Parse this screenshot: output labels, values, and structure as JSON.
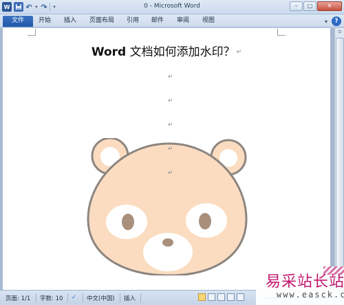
{
  "window": {
    "title": "0 - Microsoft Word",
    "minimize": "–",
    "maximize": "□",
    "close": "✕"
  },
  "qat": {
    "word_logo": "W",
    "icons": [
      "word-logo-icon",
      "save-icon",
      "undo-icon",
      "redo-icon",
      "customize-dropdown-icon"
    ]
  },
  "ribbon": {
    "tabs": [
      "文件",
      "开始",
      "插入",
      "页面布局",
      "引用",
      "邮件",
      "审阅",
      "视图"
    ],
    "help": "?"
  },
  "document": {
    "title_bold": "Word",
    "title_rest": " 文档如何添加水印？",
    "paragraph_mark": "↵",
    "empty_paragraphs": 5,
    "watermark_image": "bear-face",
    "colors": {
      "bear_fill": "#fbdcc0",
      "bear_outline": "#8c8580",
      "bear_white": "#ffffff",
      "bear_eyes": "#a9907d"
    }
  },
  "status": {
    "page": "页面: 1/1",
    "words": "字数: 10",
    "language": "中文(中国)",
    "mode": "插入"
  },
  "site_watermark": {
    "chinese": "易采站长站",
    "url": "www.easck.com",
    "color": "#c0176d"
  }
}
